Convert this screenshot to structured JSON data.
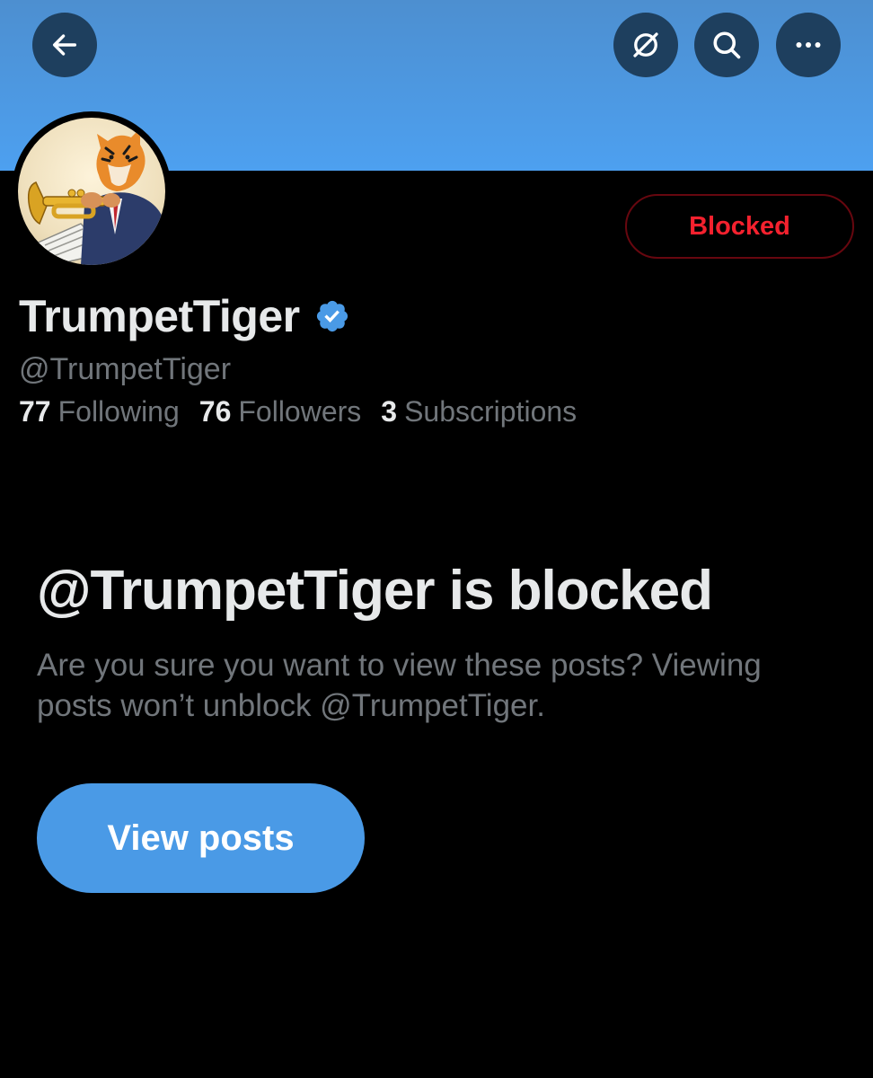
{
  "header": {
    "back_icon": "arrow-left-icon",
    "grok_icon": "grok-slash-circle-icon",
    "search_icon": "search-icon",
    "more_icon": "more-horizontal-icon",
    "banner_color": "#4a9ae6"
  },
  "profile": {
    "avatar_icon": "tiger-playing-trumpet-avatar",
    "display_name": "TrumpetTiger",
    "verified_icon": "verified-badge-icon",
    "verified_color": "#4a9ae6",
    "handle": "@TrumpetTiger",
    "blocked_button_label": "Blocked",
    "blocked_color": "#f4212e",
    "stats": {
      "following_count": "77",
      "following_label": "Following",
      "followers_count": "76",
      "followers_label": "Followers",
      "subscriptions_count": "3",
      "subscriptions_label": "Subscriptions"
    }
  },
  "blocked_notice": {
    "title": "@TrumpetTiger is blocked",
    "description": "Are you sure you want to view these posts? Viewing posts won’t unblock @TrumpetTiger.",
    "view_posts_label": "View posts"
  }
}
